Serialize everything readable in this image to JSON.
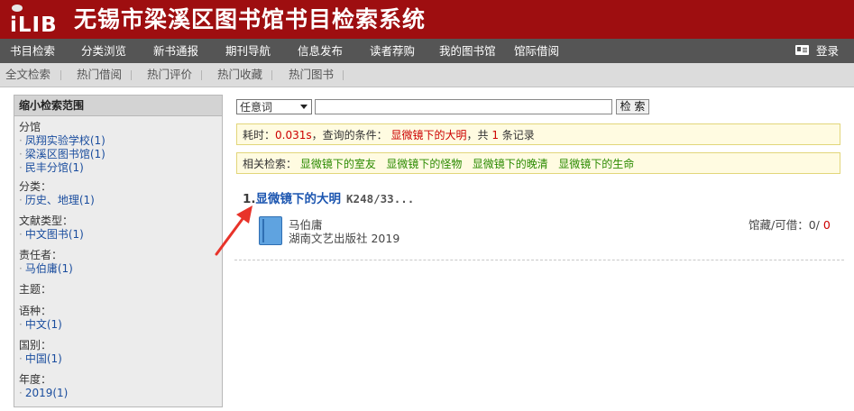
{
  "header": {
    "logo_text": "iLIB",
    "title": "无锡市梁溪区图书馆书目检索系统"
  },
  "main_nav": [
    "书目检索",
    "分类浏览",
    "新书通报",
    "期刊导航",
    "信息发布",
    "读者荐购",
    "我的图书馆",
    "馆际借阅"
  ],
  "login_label": "登录",
  "sub_nav": [
    "全文检索",
    "热门借阅",
    "热门评价",
    "热门收藏",
    "热门图书"
  ],
  "sidebar": {
    "heading": "缩小检索范围",
    "sections": [
      {
        "label": "分馆",
        "options": [
          "凤翔实验学校(1)",
          "梁溪区图书馆(1)",
          "民丰分馆(1)"
        ]
      },
      {
        "label": "分类：",
        "options": [
          "历史、地理(1)"
        ]
      },
      {
        "label": "文献类型：",
        "options": [
          "中文图书(1)"
        ]
      },
      {
        "label": "责任者：",
        "options": [
          "马伯庸(1)"
        ]
      },
      {
        "label": "主题：",
        "options": []
      },
      {
        "label": "语种：",
        "options": [
          "中文(1)"
        ]
      },
      {
        "label": "国别：",
        "options": [
          "中国(1)"
        ]
      },
      {
        "label": "年度：",
        "options": [
          "2019(1)"
        ]
      }
    ]
  },
  "search": {
    "field_select": "任意词",
    "query": "",
    "button": "检 索"
  },
  "result_info": {
    "time_label": "耗时：",
    "time_value": "0.031s",
    "cond_label": "，查询的条件：",
    "cond_value": "显微镜下的大明",
    "count_prefix": "，共 ",
    "count": "1",
    "count_suffix": " 条记录"
  },
  "related": {
    "label": "相关检索：",
    "items": [
      "显微镜下的室友",
      "显微镜下的怪物",
      "显微镜下的晚清",
      "显微镜下的生命"
    ]
  },
  "results": [
    {
      "index": "1.",
      "title": "显微镜下的大明",
      "call_no": "K248/33...",
      "author": "马伯庸",
      "publisher": "湖南文艺出版社 2019",
      "avail_label": "馆藏/可借：",
      "holdings": "0",
      "available": "0"
    }
  ],
  "colors": {
    "header_bg": "#9e0e10",
    "nav_bg": "#555555",
    "subnav_bg": "#dcdcdc",
    "link": "#1a4d9e",
    "highlight": "#cc0000",
    "related": "#2a8a00",
    "annotation_arrow": "#e8332a"
  }
}
